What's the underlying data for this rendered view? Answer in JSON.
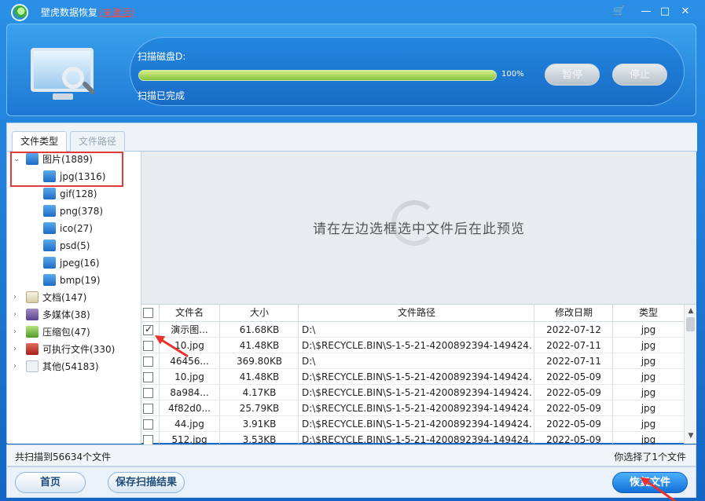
{
  "window": {
    "title": "壁虎数据恢复",
    "activation": "(未激活)",
    "controls": {
      "cart": "🛒",
      "minimize": "—",
      "maximize": "□",
      "close": "✕"
    }
  },
  "scan": {
    "label": "扫描磁盘D:",
    "progress_percent": 100,
    "progress_text": "100%",
    "status": "扫描已完成",
    "pause_label": "暂停",
    "stop_label": "停止"
  },
  "tabs": {
    "file_type": "文件类型",
    "file_path": "文件路径"
  },
  "tree": {
    "root": {
      "label": "图片(1889)"
    },
    "children": [
      {
        "label": "jpg(1316)"
      },
      {
        "label": "gif(128)"
      },
      {
        "label": "png(378)"
      },
      {
        "label": "ico(27)"
      },
      {
        "label": "psd(5)"
      },
      {
        "label": "jpeg(16)"
      },
      {
        "label": "bmp(19)"
      }
    ],
    "categories": [
      {
        "label": "文档(147)",
        "icon": "document-icon"
      },
      {
        "label": "多媒体(38)",
        "icon": "media-icon"
      },
      {
        "label": "压缩包(47)",
        "icon": "archive-icon"
      },
      {
        "label": "可执行文件(330)",
        "icon": "executable-icon"
      },
      {
        "label": "其他(54183)",
        "icon": "other-icon"
      }
    ]
  },
  "preview": {
    "hint": "请在左边选框选中文件后在此预览"
  },
  "table": {
    "headers": {
      "name": "文件名",
      "size": "大小",
      "path": "文件路径",
      "date": "修改日期",
      "type": "类型"
    },
    "rows": [
      {
        "checked": true,
        "name": "演示图...",
        "size": "61.68KB",
        "path": "D:\\",
        "date": "2022-07-12",
        "type": "jpg"
      },
      {
        "checked": false,
        "name": "10.jpg",
        "size": "41.48KB",
        "path": "D:\\$RECYCLE.BIN\\S-1-5-21-4200892394-149424...",
        "date": "2022-07-11",
        "type": "jpg"
      },
      {
        "checked": false,
        "name": "46456...",
        "size": "369.80KB",
        "path": "D:\\",
        "date": "2022-07-11",
        "type": "jpg"
      },
      {
        "checked": false,
        "name": "10.jpg",
        "size": "41.48KB",
        "path": "D:\\$RECYCLE.BIN\\S-1-5-21-4200892394-149424...",
        "date": "2022-05-09",
        "type": "jpg"
      },
      {
        "checked": false,
        "name": "8a984...",
        "size": "4.17KB",
        "path": "D:\\$RECYCLE.BIN\\S-1-5-21-4200892394-149424...",
        "date": "2022-05-09",
        "type": "jpg"
      },
      {
        "checked": false,
        "name": "4f82d0...",
        "size": "25.79KB",
        "path": "D:\\$RECYCLE.BIN\\S-1-5-21-4200892394-149424...",
        "date": "2022-05-09",
        "type": "jpg"
      },
      {
        "checked": false,
        "name": "44.jpg",
        "size": "3.91KB",
        "path": "D:\\$RECYCLE.BIN\\S-1-5-21-4200892394-149424...",
        "date": "2022-05-09",
        "type": "jpg"
      },
      {
        "checked": false,
        "name": "512.jpg",
        "size": "3.53KB",
        "path": "D:\\$RECYCLE.BIN\\S-1-5-21-4200892394-149424...",
        "date": "2022-05-09",
        "type": "jpg"
      }
    ]
  },
  "statusbar": {
    "scanned": "共扫描到56634个文件",
    "selected": "你选择了1个文件"
  },
  "buttons": {
    "home": "首页",
    "save_results": "保存扫描结果",
    "recover": "恢复文件"
  },
  "colors": {
    "accent": "#1a78d6",
    "annotation": "#e8322b",
    "progress": "#8cc63f"
  }
}
